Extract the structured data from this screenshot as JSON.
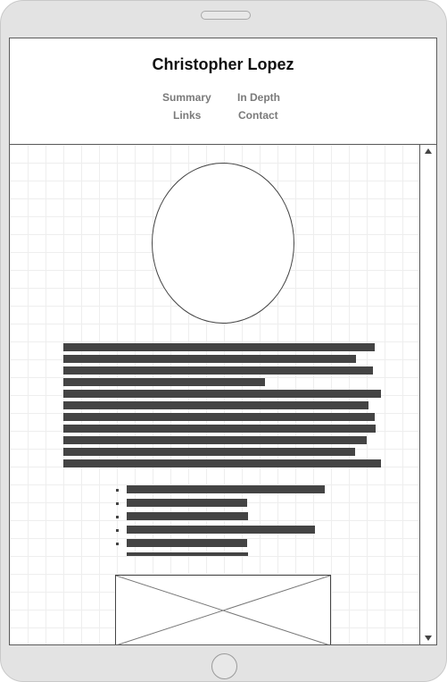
{
  "header": {
    "title": "Christopher Lopez",
    "nav": [
      {
        "label": "Summary"
      },
      {
        "label": "In Depth"
      },
      {
        "label": "Links"
      },
      {
        "label": "Contact"
      }
    ]
  },
  "icons": {
    "scroll_up": "triangle-up-icon",
    "scroll_down": "triangle-down-icon",
    "image_placeholder": "image-placeholder-icon"
  },
  "colors": {
    "device_frame": "#e3e3e3",
    "outline": "#5c5c5c",
    "text_bar": "#444444",
    "nav_link": "#7a7a7a"
  }
}
